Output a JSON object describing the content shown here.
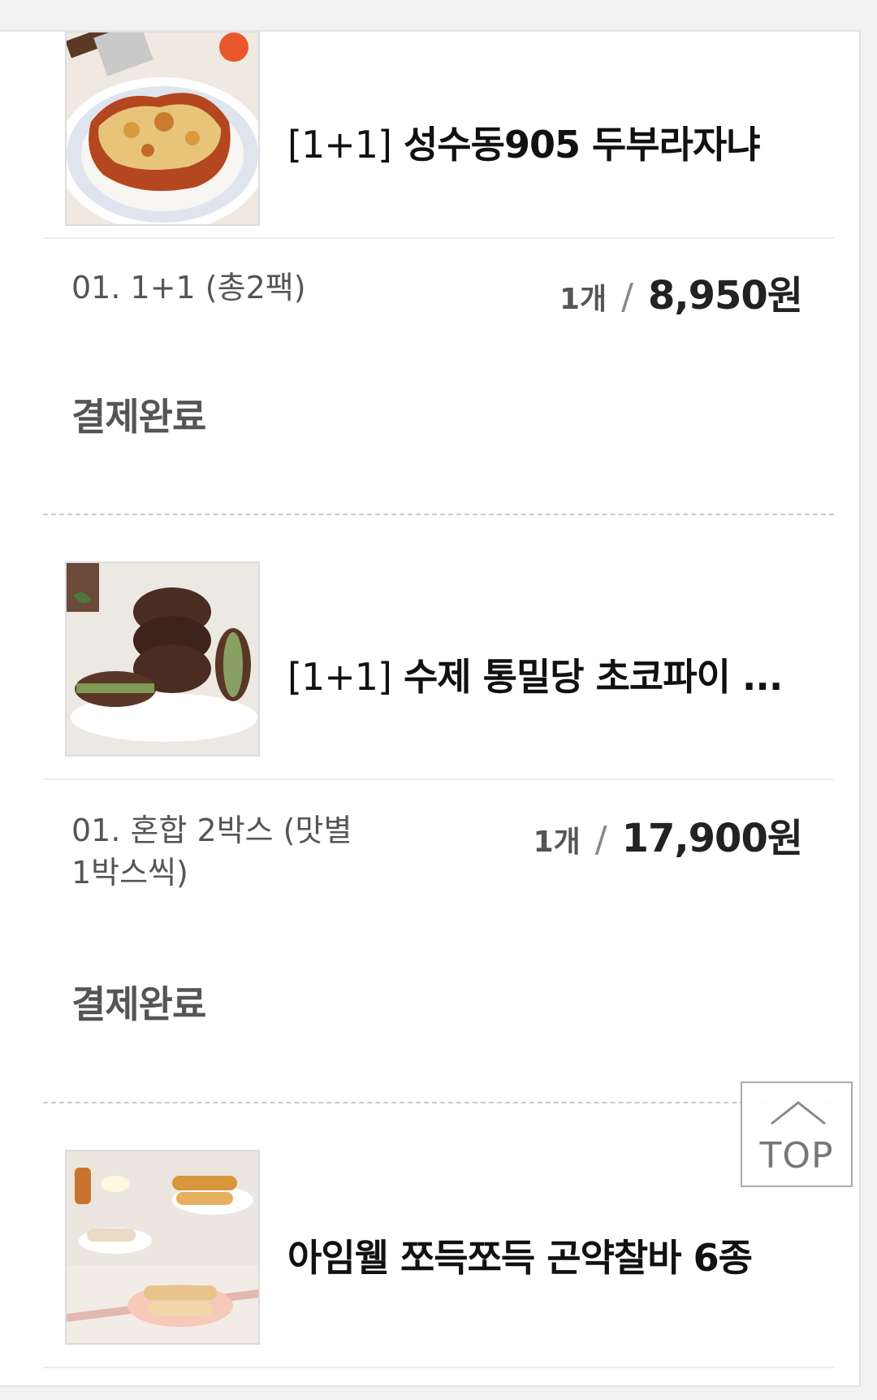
{
  "orders": [
    {
      "name_prefix": "[1+1]",
      "name": "성수동905 두부라자냐",
      "image_icon": "lasagna-product-image",
      "option": "01. 1+1 (총2팩)",
      "quantity": "1개",
      "slash": "/",
      "price": "8,950원",
      "status": "결제완료"
    },
    {
      "name_prefix": "[1+1]",
      "name": "수제 통밀당 초코파이 ...",
      "image_icon": "chocopie-product-image",
      "option": "01. 혼합 2박스 (맛별 1박스씩)",
      "quantity": "1개",
      "slash": "/",
      "price": "17,900원",
      "status": "결제완료"
    },
    {
      "name_prefix": "",
      "name": "아임웰 쪼득쪼득 곤약찰바 6종",
      "image_icon": "konjac-bar-product-image"
    }
  ],
  "top_button": {
    "label": "TOP",
    "icon": "chevron-up-icon"
  }
}
